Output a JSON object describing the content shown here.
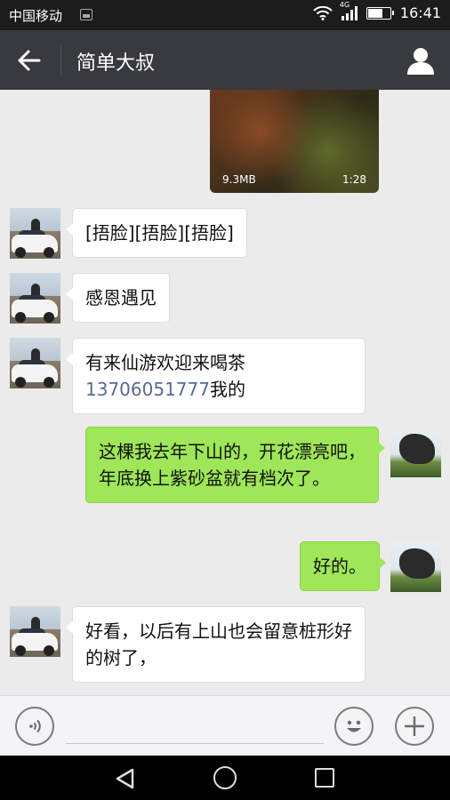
{
  "status_bar": {
    "carrier": "中国移动",
    "network": "4G",
    "time": "16:41",
    "battery_level": 0.62
  },
  "header": {
    "title": "简单大叔"
  },
  "chat": {
    "video": {
      "size": "9.3MB",
      "duration": "1:28"
    },
    "messages": [
      {
        "side": "in",
        "text": "[捂脸][捂脸][捂脸]"
      },
      {
        "side": "in",
        "text": "感恩遇见"
      },
      {
        "side": "in",
        "line1": "有来仙游欢迎来喝茶",
        "phone": "13706051777",
        "suffix": "我的"
      },
      {
        "side": "out",
        "text": "这棵我去年下山的，开花漂亮吧，年底换上紫砂盆就有档次了。"
      },
      {
        "side": "out",
        "text": "好的。"
      },
      {
        "side": "in",
        "text": "好看，以后有上山也会留意桩形好的树了，"
      }
    ]
  },
  "input": {
    "value": "",
    "placeholder": ""
  },
  "colors": {
    "header_bg": "#393a3f",
    "outgoing_bubble": "#9fe658",
    "incoming_bubble": "#ffffff",
    "chat_bg": "#ebebeb",
    "link": "#576b95"
  }
}
